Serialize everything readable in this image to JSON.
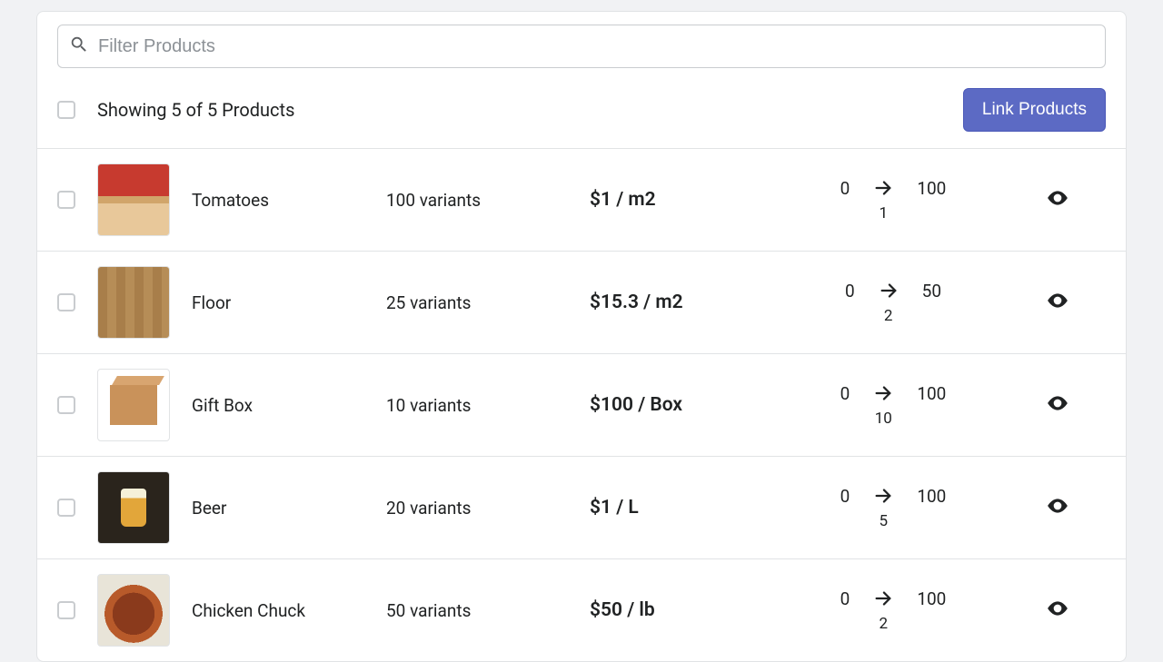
{
  "search": {
    "placeholder": "Filter Products"
  },
  "header": {
    "showing": "Showing 5 of 5 Products",
    "link_button": "Link Products"
  },
  "products": [
    {
      "name": "Tomatoes",
      "variants": "100 variants",
      "price": "$1 / m2",
      "from": "0",
      "step": "1",
      "to": "100",
      "thumb": "tomatoes"
    },
    {
      "name": "Floor",
      "variants": "25 variants",
      "price": "$15.3 / m2",
      "from": "0",
      "step": "2",
      "to": "50",
      "thumb": "floor"
    },
    {
      "name": "Gift Box",
      "variants": "10 variants",
      "price": "$100 / Box",
      "from": "0",
      "step": "10",
      "to": "100",
      "thumb": "box"
    },
    {
      "name": "Beer",
      "variants": "20 variants",
      "price": "$1 / L",
      "from": "0",
      "step": "5",
      "to": "100",
      "thumb": "beer"
    },
    {
      "name": "Chicken Chuck",
      "variants": "50 variants",
      "price": "$50 / lb",
      "from": "0",
      "step": "2",
      "to": "100",
      "thumb": "chicken"
    }
  ],
  "colors": {
    "accent": "#5c6ac4"
  }
}
